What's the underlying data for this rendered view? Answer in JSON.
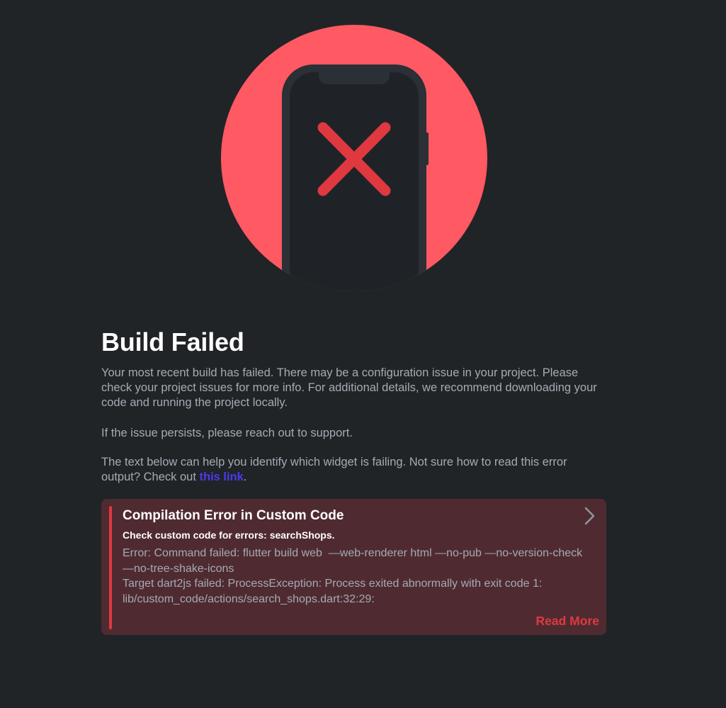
{
  "page": {
    "title": "Build Failed",
    "paragraph1": "Your most recent build has failed. There may be a configuration issue in your project. Please check your project issues for more info. For additional details, we recommend downloading your code and running the project locally.",
    "paragraph2": "If the issue persists, please reach out to support.",
    "paragraph3_prefix": "The text below can help you identify which widget is failing. Not sure how to read this error output? Check out ",
    "paragraph3_link": "this link",
    "paragraph3_suffix": "."
  },
  "illustration": {
    "icon": "phone-error-icon",
    "circle_color": "#ff5963",
    "phone_color": "#2b2f36",
    "x_color": "#e0383f"
  },
  "error_card": {
    "title": "Compilation Error in Custom Code",
    "subtitle": "Check custom code for errors: searchShops.",
    "detail_line1": "Error: Command failed: flutter build web  —web-renderer html —no-pub —no-version-check —no-tree-shake-icons",
    "detail_line2": "Target dart2js failed: ProcessException: Process exited abnormally with exit code 1: lib/custom_code/actions/search_shops.dart:32:29:",
    "read_more_label": "Read More",
    "expand_icon": "chevron-right-icon",
    "accent_color": "#e0383f",
    "background_color": "#4f2b31"
  },
  "colors": {
    "background": "#202427",
    "link": "#4b39ef",
    "body_text": "#a4abb3"
  }
}
